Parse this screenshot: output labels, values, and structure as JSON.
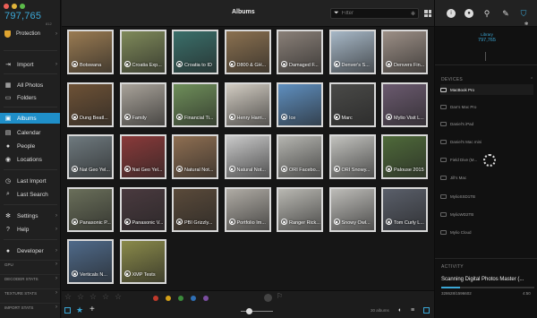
{
  "window": {
    "title": "Albums"
  },
  "sidebar": {
    "count": "797,765",
    "count_sub": "812",
    "protection_label": "Protection",
    "items": [
      {
        "label": "Import",
        "icon": "import-icon"
      },
      {
        "label": "All Photos",
        "icon": "photos-icon"
      },
      {
        "label": "Folders",
        "icon": "folder-icon"
      },
      {
        "label": "Albums",
        "icon": "albums-icon",
        "active": true
      },
      {
        "label": "Calendar",
        "icon": "calendar-icon"
      },
      {
        "label": "People",
        "icon": "person-icon"
      },
      {
        "label": "Locations",
        "icon": "location-icon"
      },
      {
        "label": "Last Import",
        "icon": "clock-icon"
      },
      {
        "label": "Last Search",
        "icon": "search-icon"
      },
      {
        "label": "Settings",
        "icon": "gear-icon"
      },
      {
        "label": "Help",
        "icon": "help-icon"
      },
      {
        "label": "Developer",
        "icon": "developer-icon"
      }
    ],
    "stats": [
      "GPU",
      "DECODER STATS",
      "TEXTURE STATS",
      "IMPORT STATS"
    ]
  },
  "toolbar": {
    "filter_placeholder": "Filter"
  },
  "albums": [
    {
      "name": "Botswana",
      "color": "#9a7b52"
    },
    {
      "name": "Croatia Exp...",
      "color": "#7f8a5a"
    },
    {
      "name": "Croatia to ID",
      "color": "#3a6f6a"
    },
    {
      "name": "D800 & GH...",
      "color": "#8b7150"
    },
    {
      "name": "Damaged F...",
      "color": "#8a8078"
    },
    {
      "name": "Denver's S...",
      "color": "#a7b8c7"
    },
    {
      "name": "Denvers Fin...",
      "color": "#9c8f86"
    },
    {
      "name": "Dung Beatl...",
      "color": "#6e5236"
    },
    {
      "name": "Family",
      "color": "#a9a39a"
    },
    {
      "name": "Financial Ti...",
      "color": "#6f8f5a"
    },
    {
      "name": "Henry Harri...",
      "color": "#d2ccc2"
    },
    {
      "name": "Ice",
      "color": "#5f8fbf"
    },
    {
      "name": "Marc",
      "color": "#4a4a48"
    },
    {
      "name": "Mylio Visit L...",
      "color": "#6b5a6f"
    },
    {
      "name": "Nat Geo Yel...",
      "color": "#6f7a7f"
    },
    {
      "name": "Nat Geo Yel...",
      "color": "#8a3a3a"
    },
    {
      "name": "Natural Not...",
      "color": "#8f6f52"
    },
    {
      "name": "Natural Not...",
      "color": "#c9c9c9"
    },
    {
      "name": "ORI Facebo...",
      "color": "#b5b5b0"
    },
    {
      "name": "ORI Snowy...",
      "color": "#c2c2be"
    },
    {
      "name": "Palouse 2015",
      "color": "#4f6a3a"
    },
    {
      "name": "Panasonic P...",
      "color": "#6a6f5a"
    },
    {
      "name": "Panasonic V...",
      "color": "#4a3a3f"
    },
    {
      "name": "PBI Grizzly...",
      "color": "#5a4a3a"
    },
    {
      "name": "Portfolio Im...",
      "color": "#b0aca5"
    },
    {
      "name": "Ranger Rick...",
      "color": "#b9b8b2"
    },
    {
      "name": "Snowy Owl...",
      "color": "#bdbcb8"
    },
    {
      "name": "Tom Curly L...",
      "color": "#5a5f6a"
    },
    {
      "name": "Verticals N...",
      "color": "#4f6a8a"
    },
    {
      "name": "XMP Tests",
      "color": "#8a8a4a"
    }
  ],
  "bottombar": {
    "album_count": "30 albums",
    "color_labels": [
      "#c0392b",
      "#d4a017",
      "#3b8a3b",
      "#2f6fb5",
      "#7b4ea0"
    ]
  },
  "right_panel": {
    "library_label": "Library",
    "library_count": "797,765",
    "devices_header": "DEVICES",
    "devices": [
      {
        "name": "MacBook Pro",
        "selected": true
      },
      {
        "name": "Dan's Mac Pro"
      },
      {
        "name": "Daniel's iPad"
      },
      {
        "name": "Daniel's Mac mini"
      },
      {
        "name": "Field Dive (M..."
      },
      {
        "name": "Jill's Mac"
      },
      {
        "name": "MylioSSD1TB"
      },
      {
        "name": "MylioWD2TB"
      },
      {
        "name": "Mylio Cloud"
      }
    ],
    "activity_header": "ACTIVITY",
    "activity_title": "Scanning Digital Photos Master (...",
    "activity_count": "328628/1596602",
    "activity_time": "4:50",
    "activity_progress": 0.2
  }
}
